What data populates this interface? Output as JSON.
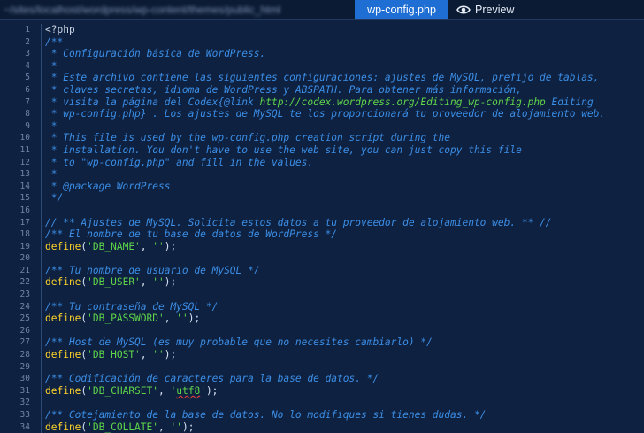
{
  "tabs": {
    "breadcrumb": "~/sites/localhost/wordpress/wp-content/themes/public_html",
    "active": "wp-config.php",
    "preview": "Preview"
  },
  "icons": {
    "preview": "eye-icon"
  },
  "colors": {
    "background": "#0f2140",
    "tab": "#1e6ed4",
    "comment": "#3b8ee6",
    "keyword": "#ffd42a",
    "string": "#5ed54a"
  },
  "editor": {
    "lines": [
      [
        {
          "t": "<?php",
          "c": "tag"
        }
      ],
      [
        {
          "t": "/**",
          "c": "c"
        }
      ],
      [
        {
          "t": " * Configuración básica de WordPress.",
          "c": "c"
        }
      ],
      [
        {
          "t": " *",
          "c": "c"
        }
      ],
      [
        {
          "t": " * Este archivo contiene las siguientes configuraciones: ajustes de MySQL, prefijo de tablas,",
          "c": "c"
        }
      ],
      [
        {
          "t": " * claves secretas, idioma de WordPress y ABSPATH. Para obtener más información,",
          "c": "c"
        }
      ],
      [
        {
          "t": " * visita la página del Codex{@link ",
          "c": "c"
        },
        {
          "t": "http://codex.wordpress.org/Editing_wp-config.php",
          "c": "u"
        },
        {
          "t": " Editing",
          "c": "c"
        }
      ],
      [
        {
          "t": " * wp-config.php} . Los ajustes de MySQL te los proporcionará tu proveedor de alojamiento web.",
          "c": "c"
        }
      ],
      [
        {
          "t": " *",
          "c": "c"
        }
      ],
      [
        {
          "t": " * This file is used by the wp-config.php creation script during the",
          "c": "c"
        }
      ],
      [
        {
          "t": " * installation. You don't have to use the web site, you can just copy this file",
          "c": "c"
        }
      ],
      [
        {
          "t": " * to \"wp-config.php\" and fill in the values.",
          "c": "c"
        }
      ],
      [
        {
          "t": " *",
          "c": "c"
        }
      ],
      [
        {
          "t": " * @package WordPress",
          "c": "c"
        }
      ],
      [
        {
          "t": " */",
          "c": "c"
        }
      ],
      [],
      [
        {
          "t": "// ** Ajustes de MySQL. Solicita estos datos a tu proveedor de alojamiento web. ** //",
          "c": "c"
        }
      ],
      [
        {
          "t": "/** El nombre de tu base de datos de WordPress */",
          "c": "c"
        }
      ],
      [
        {
          "t": "define",
          "c": "k"
        },
        {
          "t": "(",
          "c": "p"
        },
        {
          "t": "'DB_NAME'",
          "c": "s"
        },
        {
          "t": ", ",
          "c": "p"
        },
        {
          "t": "''",
          "c": "s"
        },
        {
          "t": ");",
          "c": "p"
        }
      ],
      [],
      [
        {
          "t": "/** Tu nombre de usuario de MySQL */",
          "c": "c"
        }
      ],
      [
        {
          "t": "define",
          "c": "k"
        },
        {
          "t": "(",
          "c": "p"
        },
        {
          "t": "'DB_USER'",
          "c": "s"
        },
        {
          "t": ", ",
          "c": "p"
        },
        {
          "t": "''",
          "c": "s"
        },
        {
          "t": ");",
          "c": "p"
        }
      ],
      [],
      [
        {
          "t": "/** Tu contraseña de MySQL */",
          "c": "c"
        }
      ],
      [
        {
          "t": "define",
          "c": "k"
        },
        {
          "t": "(",
          "c": "p"
        },
        {
          "t": "'DB_PASSWORD'",
          "c": "s"
        },
        {
          "t": ", ",
          "c": "p"
        },
        {
          "t": "''",
          "c": "s"
        },
        {
          "t": ");",
          "c": "p"
        }
      ],
      [],
      [
        {
          "t": "/** Host de MySQL (es muy probable que no necesites cambiarlo) */",
          "c": "c"
        }
      ],
      [
        {
          "t": "define",
          "c": "k"
        },
        {
          "t": "(",
          "c": "p"
        },
        {
          "t": "'DB_HOST'",
          "c": "s"
        },
        {
          "t": ", ",
          "c": "p"
        },
        {
          "t": "''",
          "c": "s"
        },
        {
          "t": ");",
          "c": "p"
        }
      ],
      [],
      [
        {
          "t": "/** Codificación de caracteres para la base de datos. */",
          "c": "c"
        }
      ],
      [
        {
          "t": "define",
          "c": "k"
        },
        {
          "t": "(",
          "c": "p"
        },
        {
          "t": "'DB_CHARSET'",
          "c": "s"
        },
        {
          "t": ", ",
          "c": "p"
        },
        {
          "t": "'",
          "c": "s"
        },
        {
          "t": "utf8",
          "c": "s sq"
        },
        {
          "t": "'",
          "c": "s"
        },
        {
          "t": ");",
          "c": "p"
        }
      ],
      [],
      [
        {
          "t": "/** Cotejamiento de la base de datos. No lo modifiques si tienes dudas. */",
          "c": "c"
        }
      ],
      [
        {
          "t": "define",
          "c": "k"
        },
        {
          "t": "(",
          "c": "p"
        },
        {
          "t": "'DB_COLLATE'",
          "c": "s"
        },
        {
          "t": ", ",
          "c": "p"
        },
        {
          "t": "''",
          "c": "s"
        },
        {
          "t": ");",
          "c": "p"
        }
      ]
    ]
  }
}
